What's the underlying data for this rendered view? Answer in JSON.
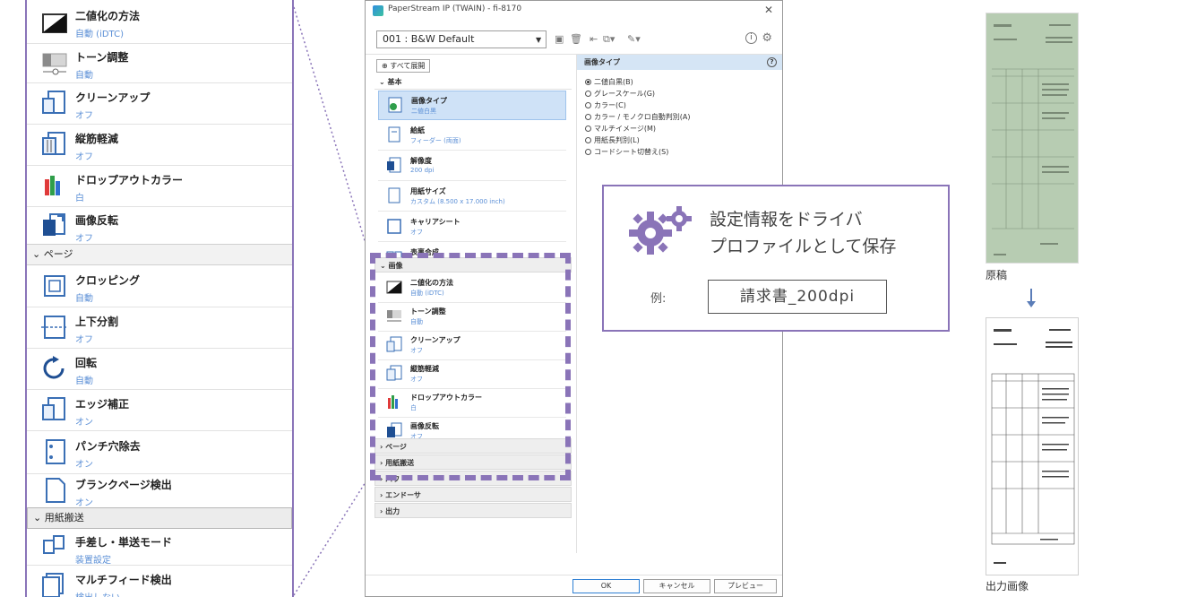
{
  "zoom_panel": {
    "items_top": [
      {
        "label": "二値化の方法",
        "sub": "自動 (iDTC)",
        "icon": "binarization-icon"
      },
      {
        "label": "トーン調整",
        "sub": "自動",
        "icon": "tone-icon"
      },
      {
        "label": "クリーンアップ",
        "sub": "オフ",
        "icon": "cleanup-icon"
      },
      {
        "label": "縦筋軽減",
        "sub": "オフ",
        "icon": "streak-icon"
      },
      {
        "label": "ドロップアウトカラー",
        "sub": "白",
        "icon": "dropout-color-icon"
      },
      {
        "label": "画像反転",
        "sub": "オフ",
        "icon": "invert-icon"
      }
    ],
    "section_page": "ページ",
    "items_page": [
      {
        "label": "クロッピング",
        "sub": "自動",
        "icon": "crop-icon"
      },
      {
        "label": "上下分割",
        "sub": "オフ",
        "icon": "split-icon"
      },
      {
        "label": "回転",
        "sub": "自動",
        "icon": "rotate-icon"
      },
      {
        "label": "エッジ補正",
        "sub": "オン",
        "icon": "edge-icon"
      },
      {
        "label": "パンチ穴除去",
        "sub": "オン",
        "icon": "punch-hole-icon"
      },
      {
        "label": "ブランクページ検出",
        "sub": "オン",
        "icon": "blank-page-icon"
      }
    ],
    "section_feed": "用紙搬送",
    "items_feed": [
      {
        "label": "手差し・単送モード",
        "sub": "装置設定",
        "icon": "manual-feed-icon"
      },
      {
        "label": "マルチフィード検出",
        "sub": "検出しない",
        "icon": "multifeed-icon"
      }
    ]
  },
  "dialog": {
    "title": "PaperStream IP (TWAIN) - fi-8170",
    "close": "✕",
    "profile": "001 : B&W Default",
    "expand_all": "すべて展開",
    "sections": {
      "basic": "基本",
      "image": "画像",
      "page": "ページ",
      "feed": "用紙搬送",
      "power": "パワ",
      "endorser": "エンドーサ",
      "output": "出力"
    },
    "basic_items": [
      {
        "label": "画像タイプ",
        "sub": "二値白黒"
      },
      {
        "label": "給紙",
        "sub": "フィーダー (両面)"
      },
      {
        "label": "解像度",
        "sub": "200 dpi"
      },
      {
        "label": "用紙サイズ",
        "sub": "カスタム (8.500 x 17.000 inch)"
      },
      {
        "label": "キャリアシート",
        "sub": "オフ"
      },
      {
        "label": "表裏合成",
        "sub": "オフ"
      }
    ],
    "image_items": [
      {
        "label": "二値化の方法",
        "sub": "自動 (iDTC)"
      },
      {
        "label": "トーン調整",
        "sub": "自動"
      },
      {
        "label": "クリーンアップ",
        "sub": "オフ"
      },
      {
        "label": "縦筋軽減",
        "sub": "オフ"
      },
      {
        "label": "ドロップアウトカラー",
        "sub": "白"
      },
      {
        "label": "画像反転",
        "sub": "オフ"
      }
    ],
    "right_pane": {
      "header": "画像タイプ",
      "help": "?",
      "options": [
        {
          "label": "二値白黒(B)",
          "selected": true
        },
        {
          "label": "グレースケール(G)",
          "selected": false
        },
        {
          "label": "カラー(C)",
          "selected": false
        },
        {
          "label": "カラー / モノクロ自動判別(A)",
          "selected": false
        },
        {
          "label": "マルチイメージ(M)",
          "selected": false
        },
        {
          "label": "用紙長判別(L)",
          "selected": false
        },
        {
          "label": "コードシート切替え(S)",
          "selected": false
        }
      ]
    },
    "buttons": {
      "ok": "OK",
      "cancel": "キャンセル",
      "preview": "プレビュー"
    }
  },
  "callout": {
    "line1": "設定情報をドライバ",
    "line2": "プロファイルとして保存",
    "example_label": "例:",
    "example_value": "請求書_200dpi"
  },
  "documents": {
    "original_label": "原稿",
    "output_label": "出力画像"
  },
  "colors": {
    "accent": "#8a74b8",
    "selected_item": "#cfe2f7",
    "sub_text": "#5b8fd6",
    "original_paper": "#b9cdb4"
  }
}
